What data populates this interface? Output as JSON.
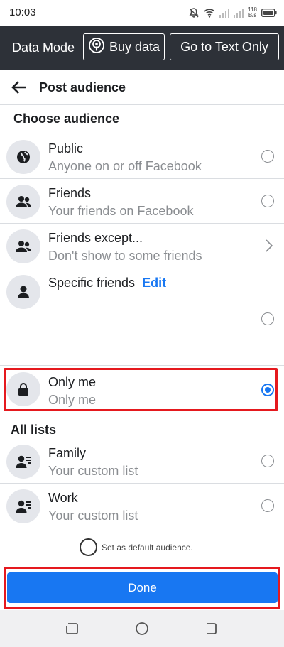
{
  "status_bar": {
    "time": "10:03",
    "net_speed_value": "118",
    "net_speed_unit": "B/s",
    "icons": [
      "mute-bell-icon",
      "wifi-icon",
      "signal-icon",
      "signal-icon",
      "battery-icon"
    ]
  },
  "data_mode_bar": {
    "label": "Data Mode",
    "buy_data_label": "Buy data",
    "text_only_label": "Go to Text Only"
  },
  "header": {
    "title": "Post audience"
  },
  "audience": {
    "section_title": "Choose audience",
    "options": [
      {
        "title": "Public",
        "subtitle": "Anyone on or off Facebook",
        "icon": "globe-icon",
        "selected": false
      },
      {
        "title": "Friends",
        "subtitle": "Your friends on Facebook",
        "icon": "friends-icon",
        "selected": false
      },
      {
        "title": "Friends except...",
        "subtitle": "Don't show to some friends",
        "icon": "friends-icon",
        "control": "chevron"
      },
      {
        "title": "Specific friends",
        "action": "Edit",
        "icon": "person-icon",
        "selected": false
      },
      {
        "title": "Only me",
        "subtitle": "Only me",
        "icon": "lock-icon",
        "selected": true
      }
    ]
  },
  "lists": {
    "section_title": "All lists",
    "items": [
      {
        "title": "Family",
        "subtitle": "Your custom list",
        "icon": "custom-list-icon",
        "selected": false
      },
      {
        "title": "Work",
        "subtitle": "Your custom list",
        "icon": "custom-list-icon",
        "selected": false
      }
    ]
  },
  "default_audience_label": "Set as default audience.",
  "done_label": "Done",
  "colors": {
    "accent": "#1877f2",
    "highlight": "#e5191e",
    "data_bar": "#2d3138"
  }
}
